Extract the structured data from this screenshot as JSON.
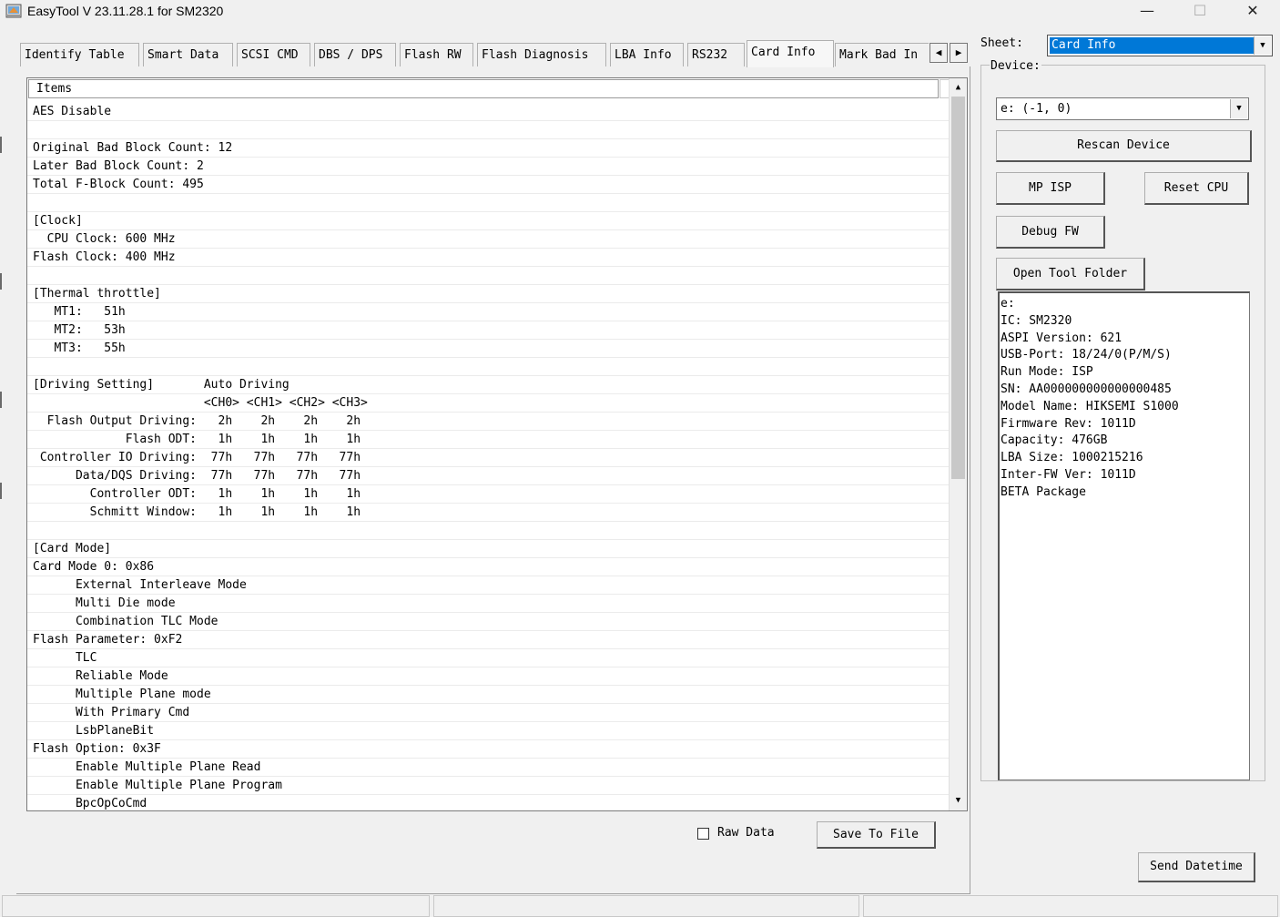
{
  "window": {
    "title": "EasyTool  V 23.11.28.1   for SM2320",
    "minimize": "—",
    "maximize": "☐",
    "close": "✕"
  },
  "tabs": [
    {
      "label": "Identify Table"
    },
    {
      "label": "Smart Data"
    },
    {
      "label": "SCSI CMD"
    },
    {
      "label": "DBS / DPS"
    },
    {
      "label": "Flash RW"
    },
    {
      "label": "Flash Diagnosis"
    },
    {
      "label": "LBA Info"
    },
    {
      "label": "RS232"
    },
    {
      "label": "Card Info",
      "active": true
    },
    {
      "label": "Mark Bad In"
    }
  ],
  "tab_scroll": {
    "left": "◀",
    "right": "▶"
  },
  "list": {
    "header": "Items",
    "rows": [
      "AES Disable",
      "",
      "Original Bad Block Count: 12",
      "Later Bad Block Count: 2",
      "Total F-Block Count: 495",
      "",
      "[Clock]",
      "  CPU Clock: 600 MHz",
      "Flash Clock: 400 MHz",
      "",
      "[Thermal throttle]",
      "   MT1:   51h",
      "   MT2:   53h",
      "   MT3:   55h",
      "",
      "[Driving Setting]       Auto Driving",
      "                        <CH0> <CH1> <CH2> <CH3>",
      "  Flash Output Driving:   2h    2h    2h    2h",
      "             Flash ODT:   1h    1h    1h    1h",
      " Controller IO Driving:  77h   77h   77h   77h",
      "      Data/DQS Driving:  77h   77h   77h   77h",
      "        Controller ODT:   1h    1h    1h    1h",
      "        Schmitt Window:   1h    1h    1h    1h",
      "",
      "[Card Mode]",
      "Card Mode 0: 0x86",
      "      External Interleave Mode",
      "      Multi Die mode",
      "      Combination TLC Mode",
      "Flash Parameter: 0xF2",
      "      TLC",
      "      Reliable Mode",
      "      Multiple Plane mode",
      "      With Primary Cmd",
      "      LsbPlaneBit",
      "Flash Option: 0x3F",
      "      Enable Multiple Plane Read",
      "      Enable Multiple Plane Program",
      "      BpcOpCoCmd"
    ]
  },
  "bottom": {
    "raw_data_label": "Raw Data",
    "raw_data_checked": false,
    "save_button": "Save To File"
  },
  "right": {
    "sheet_label": "Sheet:",
    "sheet_value": "Card Info",
    "device_label": "Device:",
    "device_value": "e: (-1, 0)",
    "rescan_button": "Rescan Device",
    "mp_isp_button": "MP ISP",
    "reset_cpu_button": "Reset CPU",
    "debug_fw_button": "Debug FW",
    "open_folder_button": "Open Tool Folder",
    "info_lines": [
      "e:",
      "IC: SM2320",
      "ASPI Version: 621",
      "USB-Port: 18/24/0(P/M/S)",
      "Run Mode: ISP",
      "SN: AA000000000000000485",
      "Model Name: HIKSEMI S1000",
      "Firmware Rev: 1011D",
      "Capacity: 476GB",
      "LBA Size: 1000215216",
      "Inter-FW Ver: 1011D",
      "BETA Package"
    ],
    "send_datetime_button": "Send Datetime"
  },
  "colors": {
    "selection": "#0078d7",
    "window_bg": "#f0f0f0"
  },
  "icons": {
    "app": "easytool-app-icon",
    "dropdown": "chevron-down-icon",
    "scroll_up": "scroll-up-arrow-icon",
    "scroll_down": "scroll-down-arrow-icon"
  }
}
